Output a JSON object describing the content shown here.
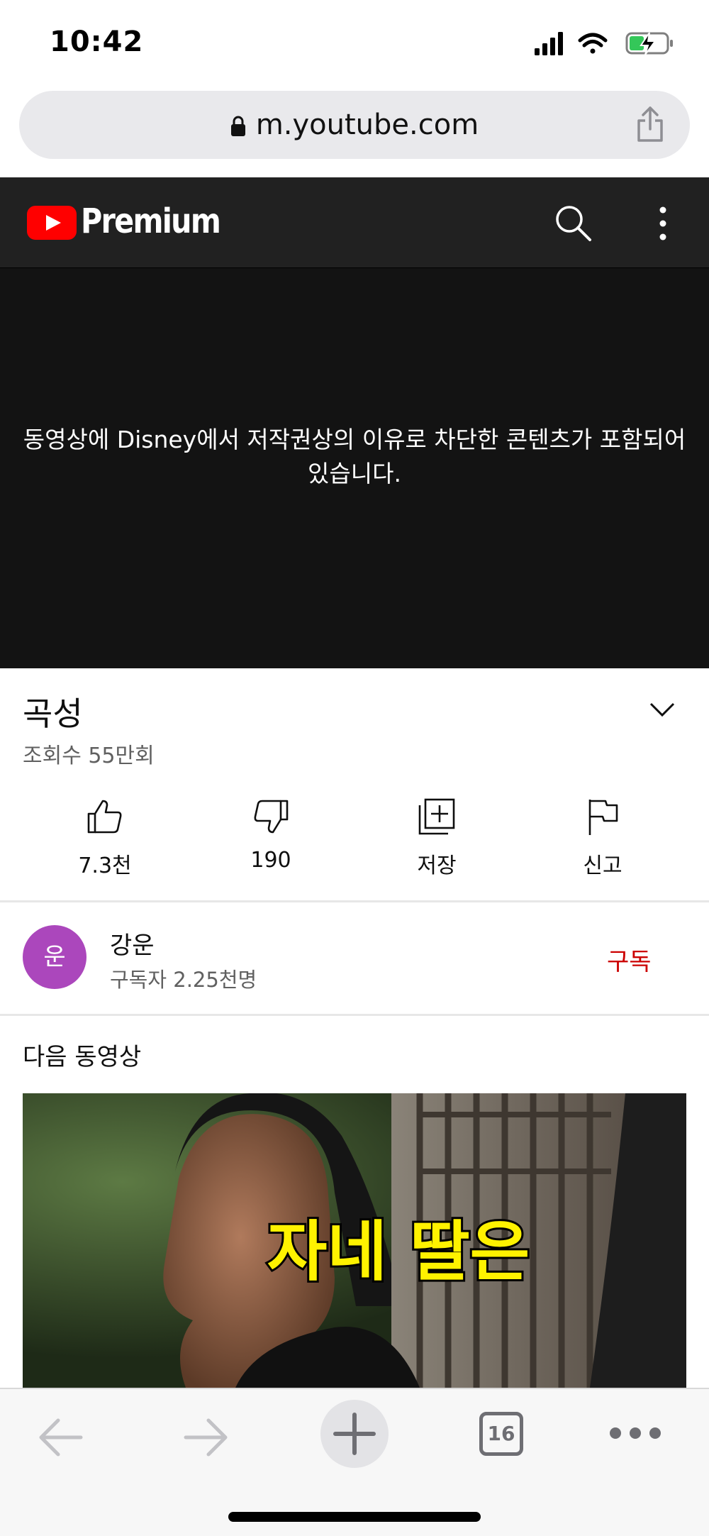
{
  "status_bar": {
    "time": "10:42"
  },
  "browser": {
    "url": "m.youtube.com",
    "tab_count": "16"
  },
  "header": {
    "brand": "Premium"
  },
  "video": {
    "blocked_message": "동영상에 Disney에서 저작권상의 이유로 차단한 콘텐츠가 포함되어 있습니다.",
    "title": "곡성",
    "views": "조회수 55만회"
  },
  "actions": {
    "like_count": "7.3천",
    "dislike_count": "190",
    "save_label": "저장",
    "report_label": "신고"
  },
  "channel": {
    "avatar_letter": "운",
    "name": "강운",
    "subscribers": "구독자 2.25천명",
    "subscribe_label": "구독"
  },
  "up_next": {
    "heading": "다음 동영상",
    "thumbnail_caption": "자네 딸은"
  },
  "colors": {
    "brand_red": "#ff0000",
    "subscribe_red": "#cc0000",
    "header_bg": "#212121",
    "avatar_bg": "#ab47bc",
    "caption_yellow": "#fff200"
  }
}
